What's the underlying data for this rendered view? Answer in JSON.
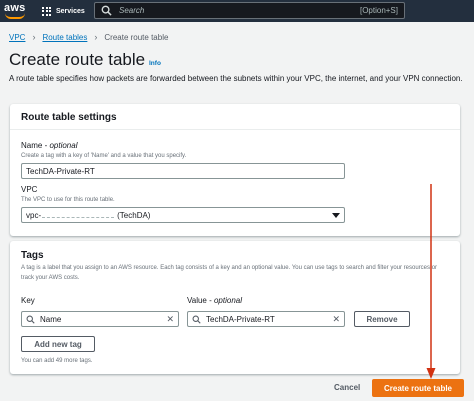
{
  "topbar": {
    "logo_text": "aws",
    "services_label": "Services",
    "search_placeholder": "Search",
    "search_shortcut": "[Option+S]"
  },
  "breadcrumb": {
    "items": [
      "VPC",
      "Route tables"
    ],
    "current": "Create route table"
  },
  "page": {
    "title": "Create route table",
    "info_link": "Info",
    "description": "A route table specifies how packets are forwarded between the subnets within your VPC, the internet, and your VPN connection."
  },
  "settings": {
    "title": "Route table settings",
    "name_label": "Name - ",
    "name_optional": "optional",
    "name_desc": "Create a tag with a key of 'Name' and a value that you specify.",
    "name_value": "TechDA-Private-RT",
    "vpc_label": "VPC",
    "vpc_desc": "The VPC to use for this route table.",
    "vpc_prefix": "vpc-",
    "vpc_suffix": "(TechDA)"
  },
  "tags": {
    "title": "Tags",
    "description": "A tag is a label that you assign to an AWS resource. Each tag consists of a key and an optional value. You can use tags to search and filter your resources or track your AWS costs.",
    "key_header": "Key",
    "value_header": "Value - ",
    "value_optional": "optional",
    "rows": [
      {
        "key": "Name",
        "value": "TechDA-Private-RT"
      }
    ],
    "remove_label": "Remove",
    "add_label": "Add new tag",
    "limit_text": "You can add 49 more tags."
  },
  "footer": {
    "cancel_label": "Cancel",
    "create_label": "Create route table"
  },
  "colors": {
    "topbar": "#232f3e",
    "link": "#0073bb",
    "primary": "#ec7211",
    "annotation_arrow": "#d13212"
  }
}
